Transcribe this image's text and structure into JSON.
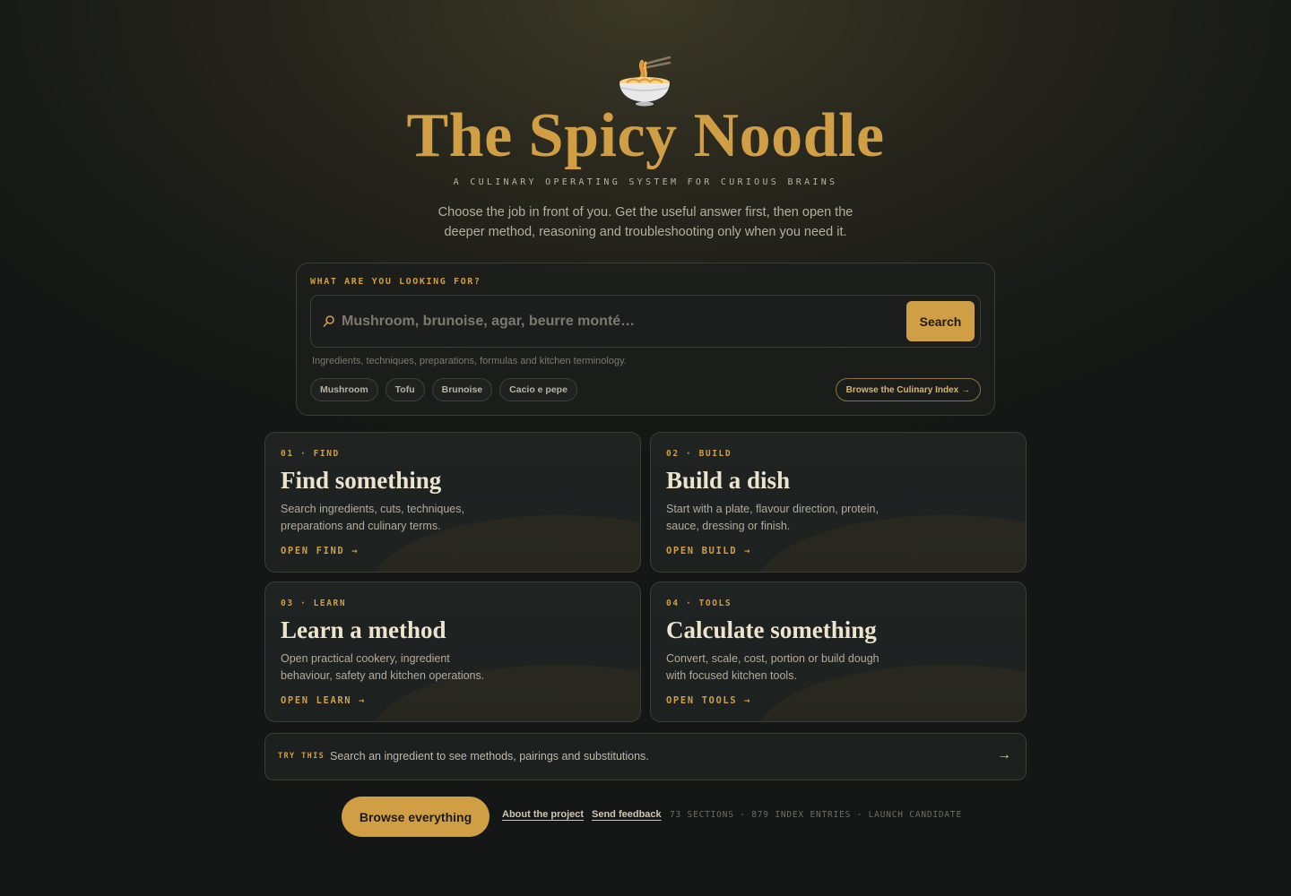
{
  "hero": {
    "title": "The Spicy Noodle",
    "subtitle": "A CULINARY OPERATING SYSTEM FOR CURIOUS BRAINS",
    "intro": "Choose the job in front of you. Get the useful answer first, then open the deeper method, reasoning and troubleshooting only when you need it."
  },
  "search": {
    "label": "WHAT ARE YOU LOOKING FOR?",
    "placeholder": "Mushroom, brunoise, agar, beurre monté…",
    "button": "Search",
    "hint": "Ingredients, techniques, preparations, formulas and kitchen terminology.",
    "chips": [
      "Mushroom",
      "Tofu",
      "Brunoise",
      "Cacio e pepe"
    ],
    "index_link": "Browse the Culinary Index →"
  },
  "cards": [
    {
      "kicker": "01 · FIND",
      "title": "Find something",
      "desc": "Search ingredients, cuts, techniques, preparations and culinary terms.",
      "link": "OPEN FIND →"
    },
    {
      "kicker": "02 · BUILD",
      "title": "Build a dish",
      "desc": "Start with a plate, flavour direction, protein, sauce, dressing or finish.",
      "link": "OPEN BUILD →"
    },
    {
      "kicker": "03 · LEARN",
      "title": "Learn a method",
      "desc": "Open practical cookery, ingredient behaviour, safety and kitchen operations.",
      "link": "OPEN LEARN →"
    },
    {
      "kicker": "04 · TOOLS",
      "title": "Calculate something",
      "desc": "Convert, scale, cost, portion or build dough with focused kitchen tools.",
      "link": "OPEN TOOLS →"
    }
  ],
  "try": {
    "label": "TRY THIS",
    "text": "Search an ingredient to see methods, pairings and substitutions.",
    "arrow": "→"
  },
  "footer": {
    "browse": "Browse everything",
    "about": "About the project",
    "feedback": "Send feedback",
    "stats": "73 SECTIONS · 879 INDEX ENTRIES · LAUNCH CANDIDATE"
  },
  "colors": {
    "accent": "#cf9e45",
    "background": "#181a17"
  },
  "icons": {
    "logo": "noodle-bowl-icon",
    "search": "search-icon",
    "arrow": "arrow-right-icon"
  }
}
